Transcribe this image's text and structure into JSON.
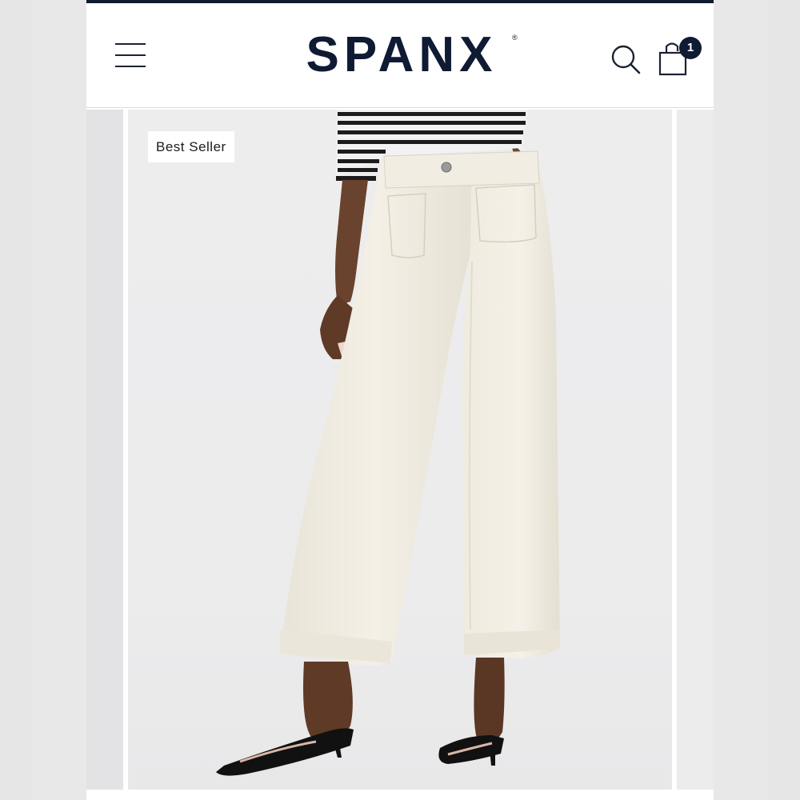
{
  "header": {
    "brand": "SPANX",
    "brand_mark": "®",
    "menu_icon": "hamburger-menu-icon",
    "search_icon": "search-icon",
    "cart_icon": "shopping-bag-icon",
    "cart_count": "1"
  },
  "product_gallery": {
    "badge_label": "Best Seller",
    "image_subject": "product-photo-white-wide-leg-pants"
  },
  "colors": {
    "brand_navy": "#0f1a33",
    "background": "#ececed",
    "pants": "#f1ede2",
    "top_stripe": "#1c1c1c"
  }
}
